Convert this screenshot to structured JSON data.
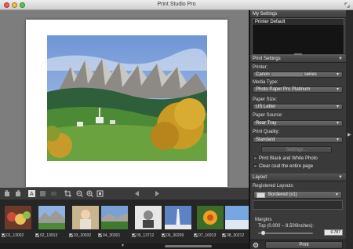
{
  "window": {
    "title": "Print Studio Pro"
  },
  "my_settings": {
    "header": "My Settings",
    "items": [
      "Printer Default"
    ]
  },
  "print_settings": {
    "header": "Print Settings",
    "printer_label": "Printer:",
    "printer_value_prefix": "Canon",
    "printer_value_suffix": "series",
    "media_type_label": "Media Type:",
    "media_type_value": "Photo Paper Pro Platinum",
    "paper_size_label": "Paper Size:",
    "paper_size_value": "US Letter",
    "paper_source_label": "Paper Source:",
    "paper_source_value": "Rear Tray",
    "print_quality_label": "Print Quality:",
    "print_quality_value": "Standard",
    "settings_button": "Settings...",
    "bw_checkbox": "Print Black and White Photo",
    "clear_coat_checkbox": "Clear coat the entire page"
  },
  "layout": {
    "header": "Layout",
    "registered_label": "Registered Layouts",
    "layout_value": "Bordered (x1)",
    "margins_label": "Margins",
    "top_label": "Top (0.000 – 8.500inches):",
    "top_value": "0.787",
    "top_range": [
      0.0,
      8.5
    ]
  },
  "print_button": "Print",
  "thumbnails": [
    {
      "caption": "01_13002"
    },
    {
      "caption": "02_13913"
    },
    {
      "caption": "03_20932"
    },
    {
      "caption": "04_30301"
    },
    {
      "caption": "05_13712"
    },
    {
      "caption": "06_30209"
    },
    {
      "caption": "07_16913"
    },
    {
      "caption": "08_30212"
    }
  ]
}
